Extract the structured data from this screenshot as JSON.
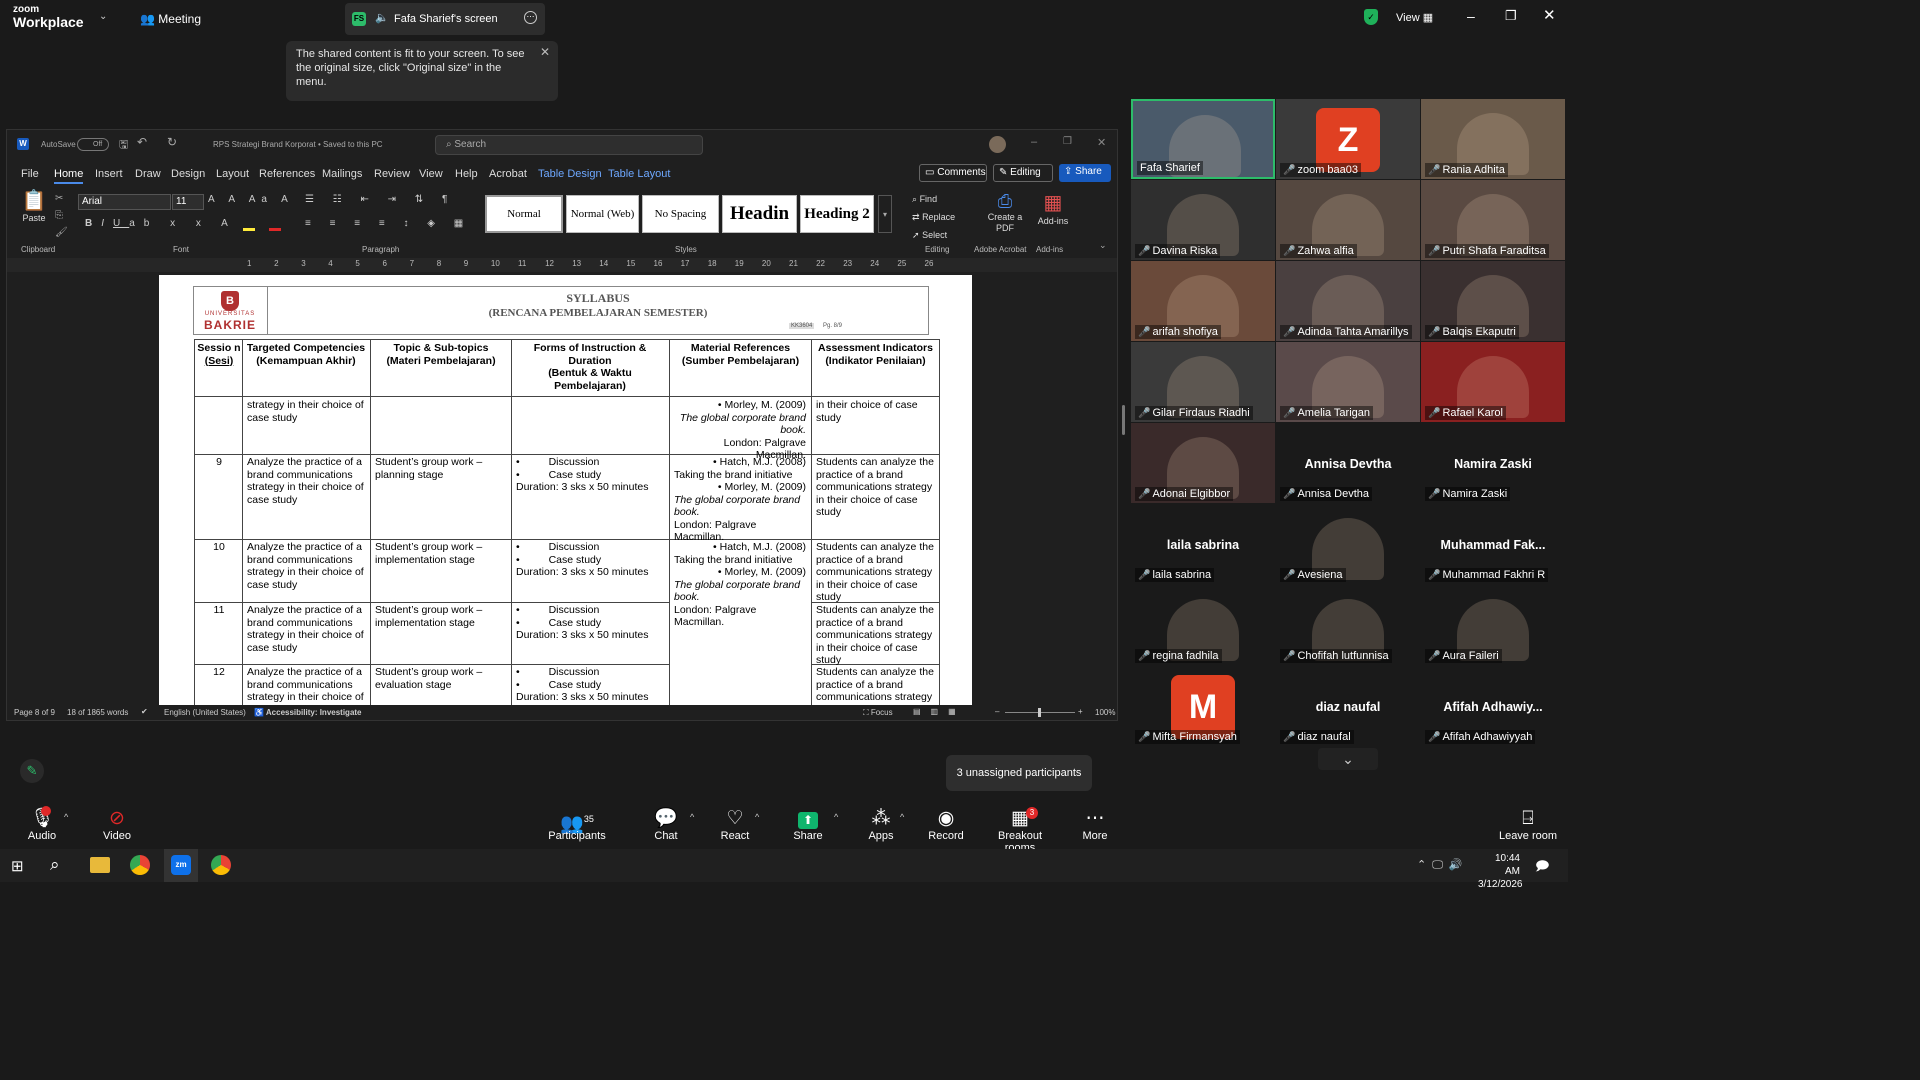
{
  "zoom": {
    "brand_line1": "zoom",
    "brand_line2": "Workplace",
    "meeting_label": "Meeting",
    "share_initials": "FS",
    "share_title": "Fafa Sharief's screen",
    "view_label": "View",
    "toast": "The shared content is fit to your screen. To see the original size, click \"Original size\" in the menu."
  },
  "word": {
    "autosave": "AutoSave",
    "autosave_state": "Off",
    "doc_title": "RPS Strategi Brand Korporat • Saved to this PC",
    "search_placeholder": "Search",
    "tabs": [
      "File",
      "Home",
      "Insert",
      "Draw",
      "Design",
      "Layout",
      "References",
      "Mailings",
      "Review",
      "View",
      "Help",
      "Acrobat",
      "Table Design",
      "Table Layout"
    ],
    "comments": "Comments",
    "editing": "Editing",
    "share": "Share",
    "paste": "Paste",
    "font_name": "Arial",
    "font_size": "11",
    "styles": [
      "Normal",
      "Normal (Web)",
      "No Spacing",
      "Headin",
      "Heading 2"
    ],
    "find": "Find",
    "replace": "Replace",
    "select": "Select",
    "create_pdf": "Create a PDF",
    "addins": "Add-ins",
    "groups": {
      "clipboard": "Clipboard",
      "font": "Font",
      "paragraph": "Paragraph",
      "styles": "Styles",
      "editing": "Editing",
      "acrobat": "Adobe Acrobat",
      "addins": "Add-ins"
    },
    "ruler": [
      "1",
      "2",
      "3",
      "4",
      "5",
      "6",
      "7",
      "8",
      "9",
      "10",
      "11",
      "12",
      "13",
      "14",
      "15",
      "16",
      "17",
      "18",
      "19",
      "20",
      "21",
      "22",
      "23",
      "24",
      "25",
      "26"
    ],
    "status": {
      "page": "Page 8 of 9",
      "words": "18 of 1865 words",
      "lang": "English (United States)",
      "access": "Accessibility: Investigate",
      "focus": "Focus",
      "zoom": "100%"
    }
  },
  "doc": {
    "logo_line1": "UNIVERSITAS",
    "logo_line2": "BAKRIE",
    "title": "SYLLABUS",
    "subtitle": "(RENCANA PEMBELAJARAN SEMESTER)",
    "code": "KK3604",
    "page": "Pg. 8/9",
    "headers": [
      {
        "a": "Sessio n",
        "b": "(Sesi)"
      },
      {
        "a": "Targeted Competencies",
        "b": "(Kemampuan Akhir)"
      },
      {
        "a": "Topic & Sub-topics",
        "b": "(Materi Pembelajaran)"
      },
      {
        "a": "Forms of Instruction & Duration",
        "b": "(Bentuk & Waktu Pembelajaran)"
      },
      {
        "a": "Material References",
        "b": "(Sumber Pembelajaran)"
      },
      {
        "a": "Assessment Indicators",
        "b": "(Indikator Penilaian)"
      }
    ],
    "cont_comp": "strategy in their choice of case study",
    "cont_ref1": "Morley, M. (2009)",
    "cont_ref2": "The global corporate brand book.",
    "cont_ref3": "London: Palgrave Macmillan.",
    "cont_assess": "in their choice of case study",
    "comp": "Analyze the practice of a brand communications strategy in their choice of case study",
    "topic_plan": "Student’s group work – planning stage",
    "topic_impl": "Student’s group work – implementation stage",
    "topic_eval": "Student’s group work – evaluation stage",
    "b1": "Discussion",
    "b2": "Case study",
    "dur": "Duration: 3 sks x 50 minutes",
    "ref_hatch1": "Hatch, M.J. (2008)",
    "ref_hatch2": "Taking the brand initiative",
    "assess": "Students can analyze the practice of a brand communications strategy in their choice of case study",
    "sessions": [
      "9",
      "10",
      "11",
      "12"
    ]
  },
  "gallery": [
    {
      "name": "Fafa Sharief"
    },
    {
      "name": "zoom baa03",
      "initial": "Z"
    },
    {
      "name": "Rania Adhita"
    },
    {
      "name": "Davina Riska"
    },
    {
      "name": "Zahwa alfia"
    },
    {
      "name": "Putri Shafa Faraditsa"
    },
    {
      "name": "arifah shofiya"
    },
    {
      "name": "Adinda Tahta Amarillys"
    },
    {
      "name": "Balqis Ekaputri"
    },
    {
      "name": "Gilar Firdaus Riadhi"
    },
    {
      "name": "Amelia Tarigan"
    },
    {
      "name": "Rafael Karol"
    },
    {
      "name": "Adonai Elgibbor"
    },
    {
      "name": "Annisa Devtha",
      "big": "Annisa Devtha"
    },
    {
      "name": "Namira Zaski",
      "big": "Namira Zaski"
    },
    {
      "name": "laila sabrina",
      "big": "laila sabrina"
    },
    {
      "name": "Avesiena"
    },
    {
      "name": "Muhammad Fakhri R",
      "big": "Muhammad Fak..."
    },
    {
      "name": "regina fadhila"
    },
    {
      "name": "Chofifah lutfunnisa"
    },
    {
      "name": "Aura Faileri"
    },
    {
      "name": "Mifta Firmansyah",
      "initial": "M"
    },
    {
      "name": "diaz naufal",
      "big": "diaz naufal"
    },
    {
      "name": "Afifah Adhawiyyah",
      "big": "Afifah Adhawiy..."
    }
  ],
  "unassigned": "3 unassigned participants",
  "toolbar": {
    "audio": "Audio",
    "video": "Video",
    "participants": "Participants",
    "participants_count": "35",
    "chat": "Chat",
    "react": "React",
    "share": "Share",
    "apps": "Apps",
    "record": "Record",
    "breakout": "Breakout rooms",
    "breakout_badge": "3",
    "more": "More",
    "leave": "Leave room"
  },
  "taskbar": {
    "time": "10:44 AM",
    "date": "3/12/2026"
  },
  "colors": {
    "accent": "#0e71eb",
    "word_blue": "#185abd",
    "share_green": "#0fb56d",
    "red": "#e02828"
  }
}
